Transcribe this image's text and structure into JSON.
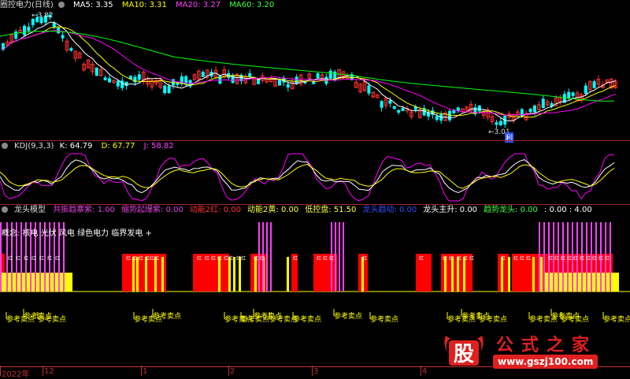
{
  "main_header": {
    "title": "圈控电力(日线)",
    "ma5": "MA5: 3.35",
    "ma10": "MA10: 3.31",
    "ma20": "MA20: 3.27",
    "ma60": "MA60: 3.20"
  },
  "main_chart": {
    "high_label": "3.82",
    "low_label": "3.01",
    "flag_label": "利"
  },
  "kdj_header": {
    "name": "KDJ(9,3,3)",
    "k": "K: 64.79",
    "d": "D: 67.77",
    "j": "J: 58.82"
  },
  "long_header": {
    "name": "龙头模型",
    "items": [
      {
        "text": "共振趋寨紫: 1.00",
        "color": "#e040e0"
      },
      {
        "text": "缩势起爆紫: 0.00",
        "color": "#e040e0"
      },
      {
        "text": "动能2红: 0.00",
        "color": "#ff3030"
      },
      {
        "text": "动能2黄: 0.00",
        "color": "#ffff40"
      },
      {
        "text": "低控盘: 51.50",
        "color": "#ffff40"
      },
      {
        "text": "龙头趋动: 0.00",
        "color": "#3050ff"
      },
      {
        "text": "龙头主升: 0.00",
        "color": "#ffffff"
      },
      {
        "text": "趋势龙头: 0.00",
        "color": "#40ff40"
      },
      {
        "text": ": 0.00 : 4.00",
        "color": "#ffffff"
      }
    ],
    "concept": "概念: 核电 光伏 风电 绿色电力 临界发电 +"
  },
  "sell_label": "参考卖点",
  "hongqi_label": "红",
  "x_axis": [
    "2022年",
    "12",
    "1",
    "2",
    "3",
    "4"
  ],
  "watermark": {
    "logo_char": "股",
    "title": "公式之家",
    "url": "www.gszj100.com"
  },
  "colors": {
    "up": "#ff3232",
    "down": "#00ffff",
    "ma5": "#ffffff",
    "ma10": "#ffff00",
    "ma20": "#ff00ff",
    "ma60": "#00ff00",
    "k": "#ffffff",
    "d": "#ffff00",
    "j": "#ff00ff",
    "red": "#ff0000",
    "yellow": "#ffff00",
    "magenta": "#ff40ff"
  }
}
